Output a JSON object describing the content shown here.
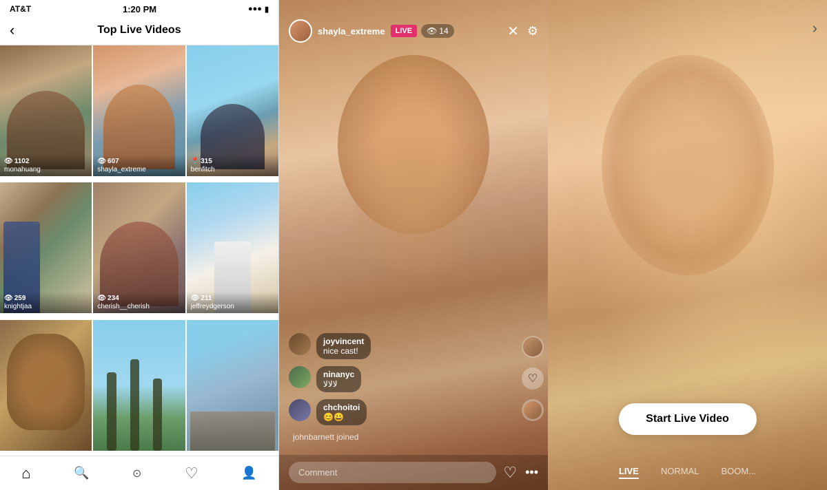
{
  "statusBar": {
    "carrier": "AT&T",
    "time": "1:20 PM",
    "battery": "🔋"
  },
  "leftPanel": {
    "backLabel": "‹",
    "title": "Top Live Videos",
    "videos": [
      {
        "id": "monahuang",
        "username": "monahuang",
        "views": "1102",
        "thumbClass": "thumb-monahuang"
      },
      {
        "id": "shayla_extreme",
        "username": "shayla_extreme",
        "views": "607",
        "thumbClass": "thumb-shayla"
      },
      {
        "id": "benfitch",
        "username": "benfitch",
        "views": "315",
        "thumbClass": "thumb-benfitch"
      },
      {
        "id": "knightjaa",
        "username": "knightjaa",
        "views": "259",
        "thumbClass": "thumb-knightjaa"
      },
      {
        "id": "cherish__cherish",
        "username": "cherish__cherish",
        "views": "234",
        "thumbClass": "thumb-cherish"
      },
      {
        "id": "jeffreydgerson",
        "username": "jeffreydgerson",
        "views": "211",
        "thumbClass": "thumb-jeffrey"
      },
      {
        "id": "dog",
        "username": "",
        "views": "",
        "thumbClass": "thumb-dog"
      },
      {
        "id": "palms",
        "username": "",
        "views": "",
        "thumbClass": "thumb-palms"
      },
      {
        "id": "beach2",
        "username": "",
        "views": "",
        "thumbClass": "thumb-beach2"
      }
    ],
    "nav": {
      "home": "⌂",
      "search": "🔍",
      "camera": "⊙",
      "heart": "♡",
      "person": "◯"
    }
  },
  "middlePanel": {
    "streamerName": "shayla_extreme",
    "liveBadge": "LIVE",
    "viewerCount": "14",
    "viewerIcon": "👁",
    "comments": [
      {
        "id": "joy",
        "user": "joyvincent",
        "text": "nice cast!",
        "avatarClass": "joy"
      },
      {
        "id": "nina",
        "user": "ninanyc",
        "text": "لالالا",
        "avatarClass": "nina"
      },
      {
        "id": "chch",
        "user": "chchoitoi",
        "text": "😊😀",
        "avatarClass": "chch"
      }
    ],
    "joinedText": "johnbarnett joined",
    "commentPlaceholder": "Comment",
    "heartIcon": "♡",
    "moreIcon": "•••"
  },
  "rightPanel": {
    "startLiveLabel": "Start Live Video",
    "tabs": [
      {
        "id": "live",
        "label": "LIVE",
        "active": true
      },
      {
        "id": "normal",
        "label": "NORMAL",
        "active": false
      },
      {
        "id": "boomerang",
        "label": "BOOM...",
        "active": false
      }
    ],
    "nextArrow": "›"
  }
}
